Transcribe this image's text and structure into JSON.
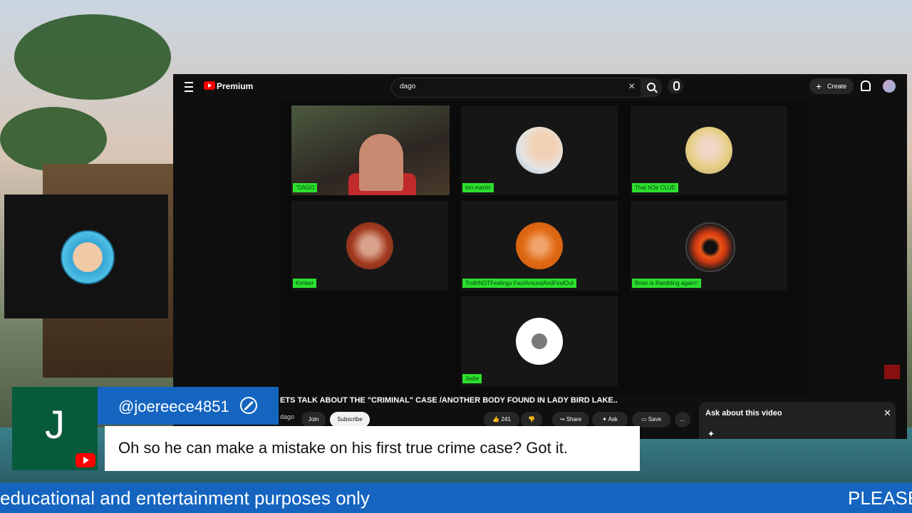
{
  "youtube": {
    "brand": "Premium",
    "search_value": "dago",
    "create_label": "Create"
  },
  "participants": [
    {
      "name": "\"DAGO"
    },
    {
      "name": "teri martin"
    },
    {
      "name": "That hOe CLUE"
    },
    {
      "name": "Kimber"
    },
    {
      "name": "TruthNOTFeelings FactAroundAndFindOut"
    },
    {
      "name": "Brian is Rambling again!!"
    },
    {
      "name": "Jodie"
    }
  ],
  "video": {
    "title": "ETS TALK ABOUT THE \"CRIMINAL\" CASE /ANOTHER BODY FOUND IN LADY BIRD LAKE..",
    "channel": "dago",
    "join_label": "Join",
    "subscribe_label": "Subscribe",
    "like_count": "241",
    "share_label": "Share",
    "ask_label": "Ask",
    "save_label": "Save",
    "more_label": "...",
    "ask_panel_title": "Ask about this video"
  },
  "comment": {
    "initial": "J",
    "username": "@joereece4851",
    "message": "Oh so he can make a mistake on his first true crime case? Got it."
  },
  "ticker": {
    "left_text": "educational and entertainment purposes only",
    "right_text": "PLEASE"
  },
  "colors": {
    "comment_bar": "#1565c0",
    "participant_label": "#2de02d",
    "youtube_red": "#ff0000"
  }
}
